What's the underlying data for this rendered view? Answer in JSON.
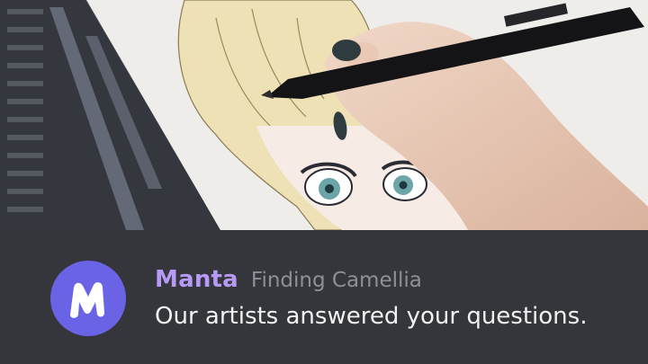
{
  "notification": {
    "app_name": "Manta",
    "series_title": "Finding Camellia",
    "message": "Our artists answered your questions.",
    "avatar_icon": "manta-logo-icon",
    "colors": {
      "bar_background": "#34363b",
      "app_name": "#b79af5",
      "series_title": "#8e9096",
      "message": "#f1f1f1",
      "avatar_background": "#6b63e6"
    }
  }
}
